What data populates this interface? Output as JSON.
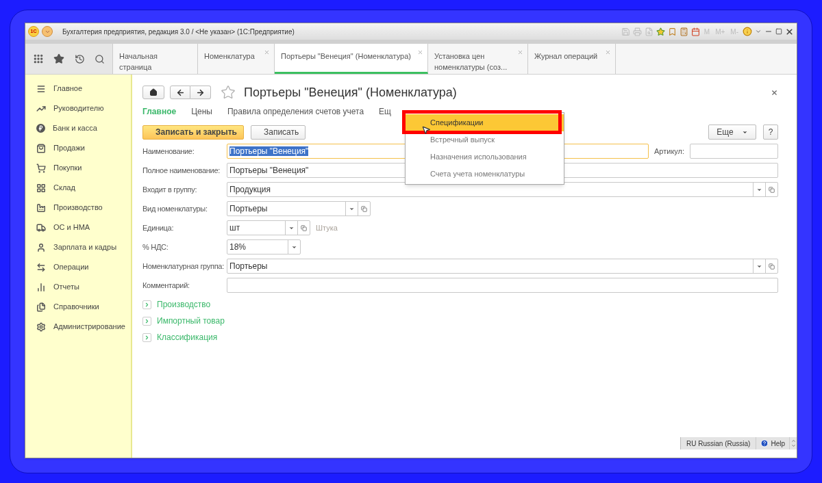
{
  "window": {
    "logo": "1С",
    "title": "Бухгалтерия предприятия, редакция 3.0 / <Не указан>  (1С:Предприятие)",
    "memory_buttons": [
      "M",
      "M+",
      "M-"
    ]
  },
  "tabs": [
    {
      "label": "Начальная страница",
      "selected": false,
      "closable": false
    },
    {
      "label": "Номенклатура",
      "selected": false,
      "closable": true
    },
    {
      "label": "Портьеры \"Венеция\" (Номенклатура)",
      "selected": true,
      "closable": true
    },
    {
      "label": "Установка цен номенклатуры (соз...",
      "selected": false,
      "closable": true
    },
    {
      "label": "Журнал операций",
      "selected": false,
      "closable": true
    }
  ],
  "sidebar": {
    "items": [
      {
        "label": "Главное"
      },
      {
        "label": "Руководителю"
      },
      {
        "label": "Банк и касса"
      },
      {
        "label": "Продажи"
      },
      {
        "label": "Покупки"
      },
      {
        "label": "Склад"
      },
      {
        "label": "Производство"
      },
      {
        "label": "ОС и НМА"
      },
      {
        "label": "Зарплата и кадры"
      },
      {
        "label": "Операции"
      },
      {
        "label": "Отчеты"
      },
      {
        "label": "Справочники"
      },
      {
        "label": "Администрирование"
      }
    ]
  },
  "form": {
    "title": "Портьеры \"Венеция\" (Номенклатура)",
    "nav": [
      {
        "label": "Главное",
        "selected": true
      },
      {
        "label": "Цены",
        "selected": false
      },
      {
        "label": "Правила определения счетов учета",
        "selected": false
      },
      {
        "label": "Ещ",
        "selected": false
      }
    ],
    "buttons": [
      {
        "label": "Записать и закрыть",
        "primary": true
      },
      {
        "label": "Записать",
        "primary": false
      }
    ],
    "more_button": "Еще",
    "help_button": "?",
    "fields": [
      {
        "label": "Наименование:",
        "value": "Портьеры \"Венеция\"",
        "kind": "text",
        "focused": true,
        "side_field": {
          "label": "Артикул:"
        }
      },
      {
        "label": "Полное наименование:",
        "value": "Портьеры \"Венеция\"",
        "kind": "text",
        "focused": false
      },
      {
        "label": "Входит в группу:",
        "value": "Продукция",
        "kind": "select_open",
        "focused": false
      },
      {
        "label": "Вид номенклатуры:",
        "value": "Портьеры",
        "kind": "select_open",
        "focused": false
      },
      {
        "label": "Единица:",
        "value": "шт",
        "kind": "select_open",
        "focused": false,
        "note": "Штука"
      },
      {
        "label": "% НДС:",
        "value": "18%",
        "kind": "select",
        "focused": false
      },
      {
        "label": "Номенклатурная группа:",
        "value": "Портьеры",
        "kind": "select_open",
        "focused": false
      },
      {
        "label": "Комментарий:",
        "kind": "text",
        "focused": false
      }
    ],
    "sections": [
      {
        "label": "Производство",
        "expanded": false
      },
      {
        "label": "Импортный товар",
        "expanded": false
      },
      {
        "label": "Классификация",
        "expanded": false
      }
    ]
  },
  "dropdown_menu": {
    "items": [
      {
        "label": "Спецификации",
        "selected": true
      },
      {
        "label": "Встречный выпуск",
        "selected": false
      },
      {
        "label": "Назначения использования",
        "selected": false
      },
      {
        "label": "Счета учета номенклатуры",
        "selected": false
      }
    ]
  },
  "status_bar": {
    "language": "RU Russian (Russia)",
    "help": "Help"
  }
}
